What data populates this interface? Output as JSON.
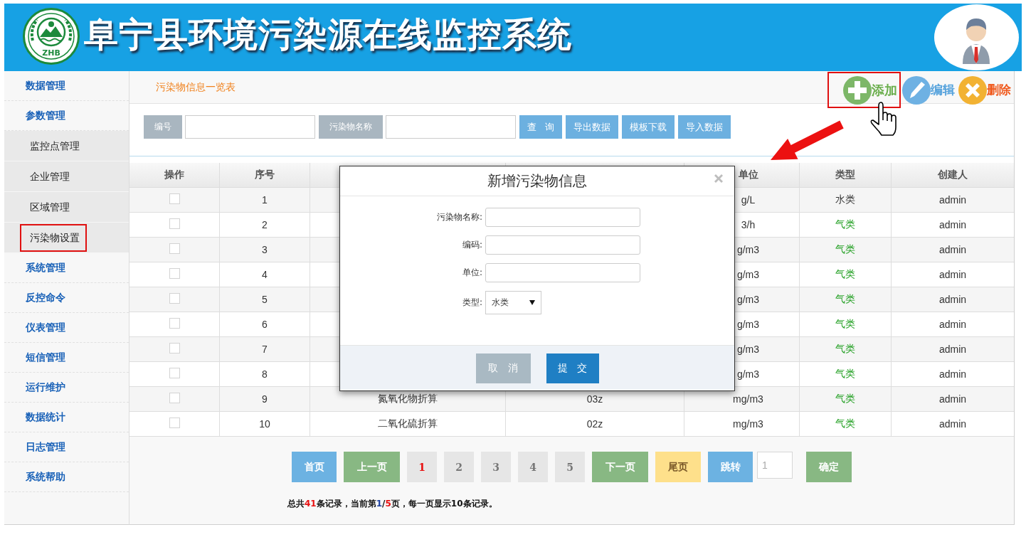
{
  "header": {
    "logo_text": "ZHB",
    "title": "阜宁县环境污染源在线监控系统"
  },
  "sidebar": {
    "items": [
      {
        "label": "数据管理"
      },
      {
        "label": "参数管理",
        "children": [
          {
            "label": "监控点管理",
            "selected": false
          },
          {
            "label": "企业管理",
            "selected": false
          },
          {
            "label": "区域管理",
            "selected": false
          },
          {
            "label": "污染物设置",
            "selected": true
          }
        ]
      },
      {
        "label": "系统管理"
      },
      {
        "label": "反控命令"
      },
      {
        "label": "仪表管理"
      },
      {
        "label": "短信管理"
      },
      {
        "label": "运行维护"
      },
      {
        "label": "数据统计"
      },
      {
        "label": "日志管理"
      },
      {
        "label": "系统帮助"
      }
    ]
  },
  "page": {
    "title": "污染物信息一览表",
    "actions": [
      {
        "kind": "add",
        "label": "添加",
        "highlighted": true
      },
      {
        "kind": "edit",
        "label": "编辑",
        "highlighted": false
      },
      {
        "kind": "delete",
        "label": "删除",
        "highlighted": false
      }
    ]
  },
  "search": {
    "fields": [
      {
        "label": "编号"
      },
      {
        "label": "污染物名称"
      }
    ],
    "buttons": [
      "查 询",
      "导出数据",
      "模板下载",
      "导入数据"
    ]
  },
  "table": {
    "columns": {
      "operation": "操作",
      "number": "序号",
      "unit": "单位",
      "type": "类型",
      "creator": "创建人"
    },
    "rows": [
      {
        "checked": false,
        "number": "1",
        "unit": "g/L",
        "type": {
          "label": "水类",
          "color": "#333333"
        },
        "creator": "admin"
      },
      {
        "checked": false,
        "number": "2",
        "unit": "3/h",
        "type": {
          "label": "气类",
          "color": "#1e9e1e"
        },
        "creator": "admin"
      },
      {
        "checked": false,
        "number": "3",
        "unit": "g/m3",
        "type": {
          "label": "气类",
          "color": "#1e9e1e"
        },
        "creator": "admin"
      },
      {
        "checked": false,
        "number": "4",
        "unit": "g/m3",
        "type": {
          "label": "气类",
          "color": "#1e9e1e"
        },
        "creator": "admin"
      },
      {
        "checked": false,
        "number": "5",
        "unit": "g/m3",
        "type": {
          "label": "气类",
          "color": "#1e9e1e"
        },
        "creator": "admin"
      },
      {
        "checked": false,
        "number": "6",
        "unit": "g/m3",
        "type": {
          "label": "气类",
          "color": "#1e9e1e"
        },
        "creator": "admin"
      },
      {
        "checked": false,
        "number": "7",
        "unit": "g/m3",
        "type": {
          "label": "气类",
          "color": "#1e9e1e"
        },
        "creator": "admin"
      },
      {
        "checked": false,
        "number": "8",
        "unit": "g/m3",
        "type": {
          "label": "气类",
          "color": "#1e9e1e"
        },
        "creator": "admin"
      },
      {
        "checked": false,
        "number": "9",
        "column_3": "氮氧化物折算",
        "column_4": "03z",
        "unit": "mg/m3",
        "type": {
          "label": "气类",
          "color": "#1e9e1e"
        },
        "creator": "admin"
      },
      {
        "checked": false,
        "number": "10",
        "column_3": "二氧化硫折算",
        "column_4": "02z",
        "unit": "mg/m3",
        "type": {
          "label": "气类",
          "color": "#1e9e1e"
        },
        "creator": "admin"
      }
    ]
  },
  "dialog": {
    "title": "新增污染物信息",
    "fields": [
      {
        "kind": "text",
        "label": "污染物名称:"
      },
      {
        "kind": "text",
        "label": "编码:"
      },
      {
        "kind": "text",
        "label": "单位:"
      },
      {
        "kind": "select",
        "label": "类型:",
        "value": "水类"
      }
    ],
    "buttons": [
      {
        "kind": "cancel",
        "label": "取 消"
      },
      {
        "kind": "submit",
        "label": "提 交"
      }
    ]
  },
  "pagination": {
    "buttons": [
      {
        "kind": "first",
        "label": "首页"
      },
      {
        "kind": "prev",
        "label": "上一页"
      },
      {
        "kind": "page",
        "label": "1",
        "selected": true
      },
      {
        "kind": "page",
        "label": "2",
        "selected": false
      },
      {
        "kind": "page",
        "label": "3",
        "selected": false
      },
      {
        "kind": "page",
        "label": "4",
        "selected": false
      },
      {
        "kind": "page",
        "label": "5",
        "selected": false
      },
      {
        "kind": "next",
        "label": "下一页"
      },
      {
        "kind": "last",
        "label": "尾页"
      },
      {
        "kind": "jump",
        "label": "跳转"
      },
      {
        "kind": "input",
        "placeholder": "1"
      },
      {
        "kind": "confirm",
        "label": "确定"
      }
    ],
    "summary": {
      "prefix": "总共",
      "total": "41",
      "middle": "条记录，当前第",
      "page": "1",
      "separator": "/",
      "pages": "5",
      "suffix": "页，每一页显示10条记录。"
    }
  }
}
